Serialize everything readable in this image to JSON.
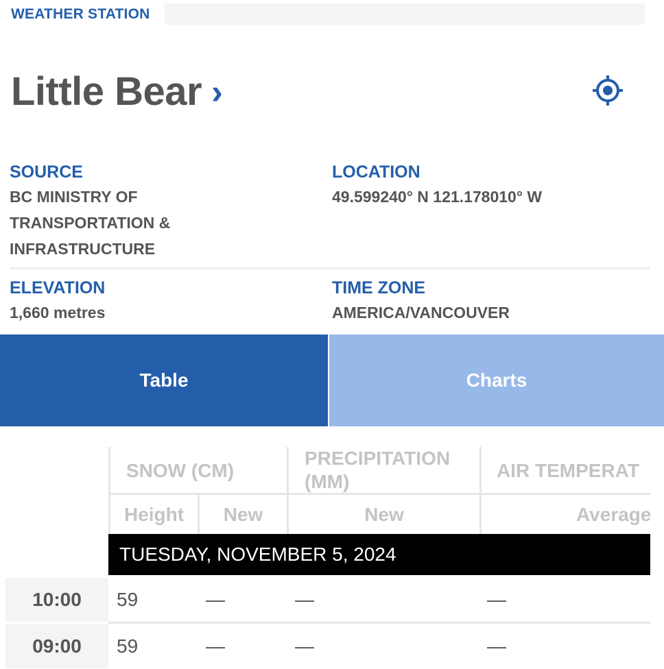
{
  "header": {
    "section_label": "WEATHER STATION",
    "station_name": "Little Bear",
    "chevron": "›",
    "locate_icon": "crosshair-icon",
    "accent_color": "#245eab"
  },
  "info": {
    "source": {
      "label": "SOURCE",
      "lines": [
        "BC MINISTRY OF",
        "TRANSPORTATION &",
        "INFRASTRUCTURE"
      ]
    },
    "location": {
      "label": "LOCATION",
      "value": "49.599240° N 121.178010° W"
    },
    "elevation": {
      "label": "ELEVATION",
      "value": "1,660 metres"
    },
    "timezone": {
      "label": "TIME ZONE",
      "value": "AMERICA/VANCOUVER"
    }
  },
  "tabs": {
    "table": "Table",
    "charts": "Charts",
    "active": "Table",
    "active_color": "#245eab",
    "inactive_color": "#97b8e8"
  },
  "table": {
    "group_headers": {
      "snow": "SNOW (CM)",
      "precip_line1": "PRECIPITATION",
      "precip_line2": "(MM)",
      "air_temp": "AIR TEMPERAT"
    },
    "sub_headers": {
      "snow_height": "Height",
      "snow_new": "New",
      "precip_new": "New",
      "air_average": "Average"
    },
    "date_band": "TUESDAY, NOVEMBER 5, 2024",
    "rows": [
      {
        "time": "10:00",
        "snow_height": "59",
        "snow_new": "—",
        "precip_new": "—",
        "air_average": "—"
      },
      {
        "time": "09:00",
        "snow_height": "59",
        "snow_new": "—",
        "precip_new": "—",
        "air_average": "—"
      }
    ]
  }
}
